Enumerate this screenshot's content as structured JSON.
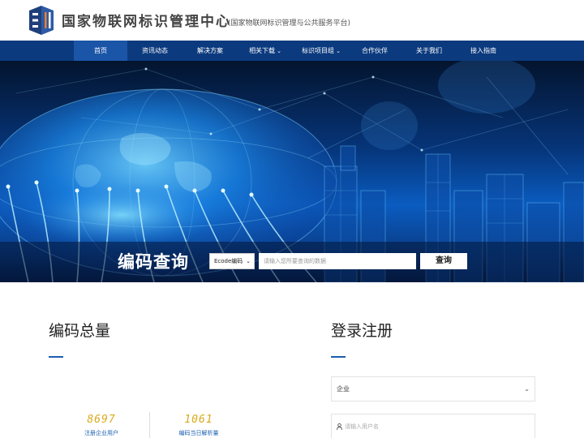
{
  "header": {
    "title": "国家物联网标识管理中心",
    "subtitle": "(国家物联网标识管理与公共服务平台)"
  },
  "nav": {
    "items": [
      {
        "label": "首页",
        "active": true,
        "dropdown": false
      },
      {
        "label": "资讯动态",
        "active": false,
        "dropdown": false
      },
      {
        "label": "解决方案",
        "active": false,
        "dropdown": false
      },
      {
        "label": "相关下载",
        "active": false,
        "dropdown": true
      },
      {
        "label": "标识项目组",
        "active": false,
        "dropdown": true
      },
      {
        "label": "合作伙伴",
        "active": false,
        "dropdown": false
      },
      {
        "label": "关于我们",
        "active": false,
        "dropdown": false
      },
      {
        "label": "接入指南",
        "active": false,
        "dropdown": false
      }
    ]
  },
  "search": {
    "title": "编码查询",
    "type_selected": "Ecode编码",
    "placeholder": "请输入您所要查询的数据",
    "button_label": "查询"
  },
  "stats": {
    "title": "编码总量",
    "items": [
      {
        "value": "8697",
        "label": "注册企业用户"
      },
      {
        "value": "1061",
        "label": "编码当日解析量"
      }
    ]
  },
  "login": {
    "title": "登录注册",
    "user_type_selected": "企业",
    "username_placeholder": "请输入用户名"
  },
  "colors": {
    "nav_bg": "#0b3a7e",
    "nav_active": "#1b55a8",
    "accent": "#1b5fb0",
    "stat_value": "#d8a91c"
  },
  "icons": {
    "logo": "ei-logo",
    "dropdown": "chevron-down-icon",
    "user": "user-icon"
  }
}
